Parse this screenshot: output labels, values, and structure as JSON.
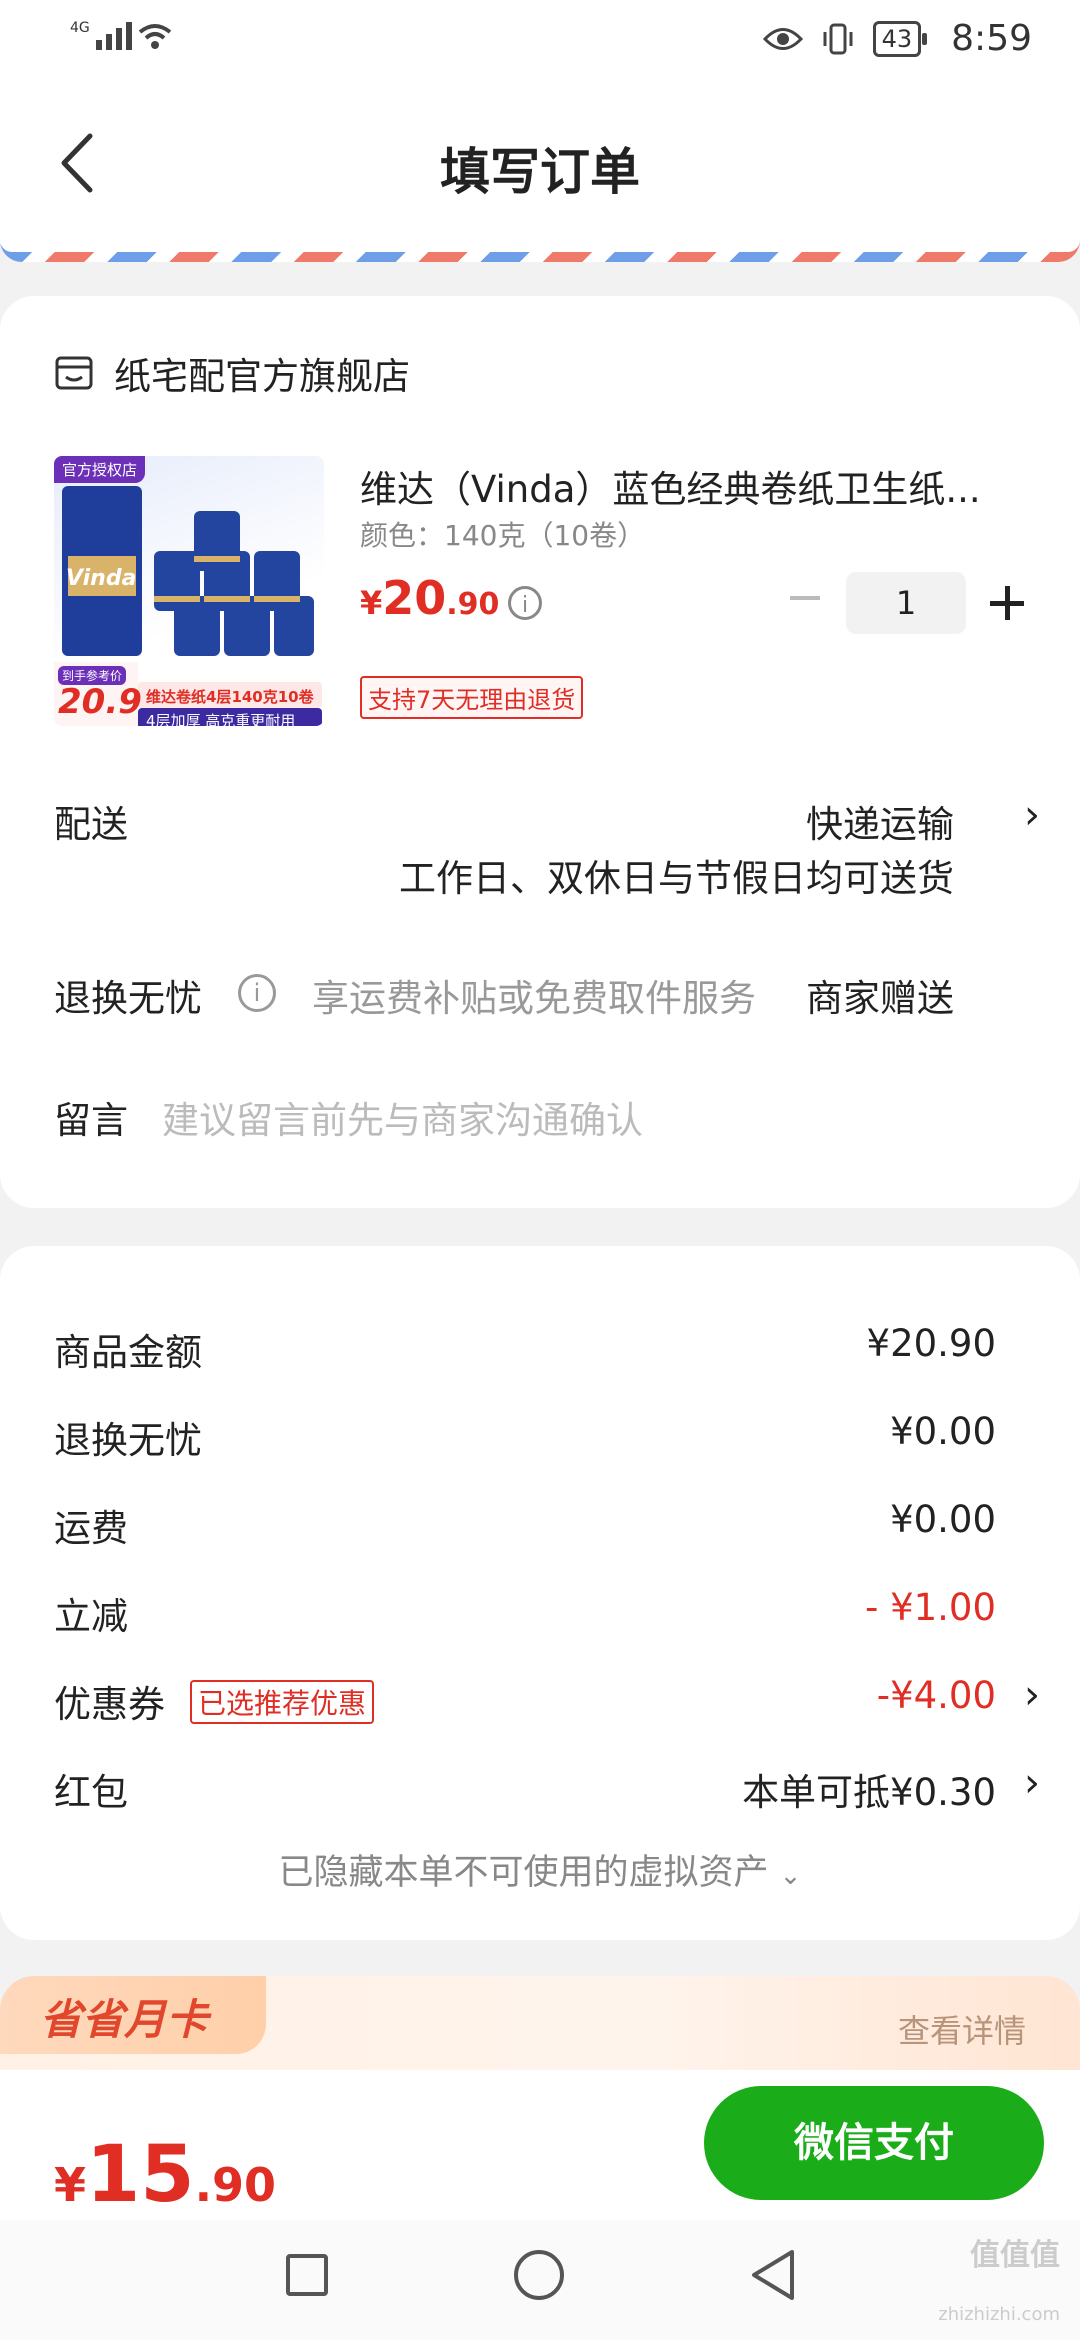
{
  "status_bar": {
    "network": "4G",
    "battery": "43",
    "time": "8:59"
  },
  "header": {
    "title": "填写订单"
  },
  "store": {
    "name": "纸宅配官方旗舰店"
  },
  "product": {
    "name": "维达（Vinda）蓝色经典卷纸卫生纸...",
    "spec": "颜色：140克（10卷）",
    "price_symbol": "¥",
    "price_int": "20",
    "price_dec": ".90",
    "quantity": "1",
    "tag": "支持7天无理由退货",
    "image": {
      "authorized": "官方授权店",
      "brand": "Vinda",
      "ref_price_label": "到手参考价",
      "ref_price": "20.9",
      "promo_line1": "维达卷纸4层140克10卷",
      "promo_line2": "4层加厚 高克重更耐用"
    }
  },
  "delivery": {
    "label": "配送",
    "method": "快递运输",
    "note": "工作日、双休日与节假日均可送货"
  },
  "return": {
    "label": "退换无忧",
    "desc": "享运费补贴或免费取件服务",
    "value": "商家赠送"
  },
  "message": {
    "label": "留言",
    "placeholder": "建议留言前先与商家沟通确认"
  },
  "summary": {
    "goods_label": "商品金额",
    "goods_value": "¥20.90",
    "return_label": "退换无忧",
    "return_value": "¥0.00",
    "shipping_label": "运费",
    "shipping_value": "¥0.00",
    "discount_label": "立减",
    "discount_value": "- ¥1.00",
    "coupon_label": "优惠券",
    "coupon_tag": "已选推荐优惠",
    "coupon_value": "-¥4.00",
    "redpacket_label": "红包",
    "redpacket_value": "本单可抵¥0.30",
    "hidden_note": "已隐藏本单不可使用的虚拟资产"
  },
  "month_card": {
    "title": "省省月卡",
    "link": "查看详情"
  },
  "paybar": {
    "symbol": "¥",
    "total_int": "15",
    "total_dec": ".90",
    "button": "微信支付"
  },
  "watermark": {
    "text": "值值值",
    "sub": "zhizhizhi.com"
  },
  "colors": {
    "accent_red": "#e02e24",
    "pay_green": "#1aad19"
  }
}
